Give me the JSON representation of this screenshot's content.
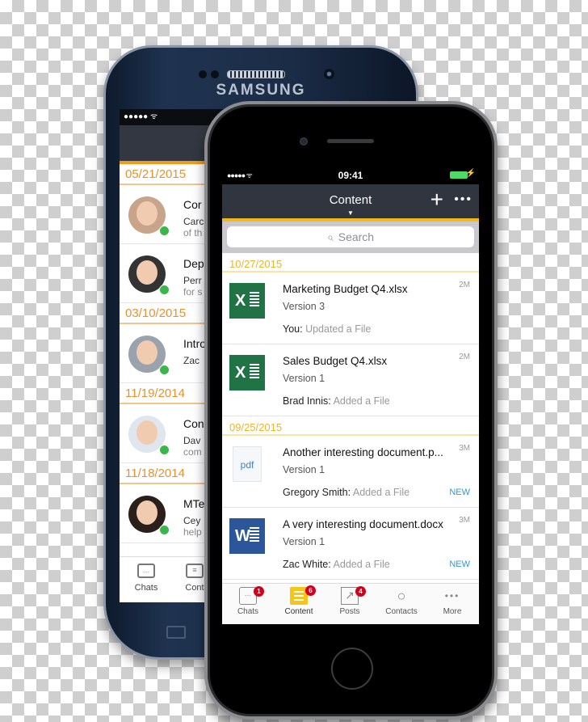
{
  "samsung": {
    "brand": "SAMSUNG",
    "status_signal": "●●●●● ᯤ",
    "groups": [
      {
        "date": "05/21/2015",
        "rows": [
          {
            "title": "Cor",
            "line1": "Carc",
            "line2": "of th"
          },
          {
            "title": "Dep",
            "line1": "Perr",
            "line2": "for s"
          }
        ]
      },
      {
        "date": "03/10/2015",
        "rows": [
          {
            "title": "Intro",
            "line1": "Zac",
            "line2": ""
          }
        ]
      },
      {
        "date": "11/19/2014",
        "rows": [
          {
            "title": "Con",
            "line1": "Dav",
            "line2": "com"
          }
        ]
      },
      {
        "date": "11/18/2014",
        "rows": [
          {
            "title": "MTe",
            "line1": "Cey",
            "line2": "help"
          }
        ]
      }
    ],
    "tabs": [
      {
        "label": "Chats",
        "icon": "chat-bubbles-icon"
      },
      {
        "label": "Cont",
        "icon": "content-list-icon"
      }
    ]
  },
  "iphone": {
    "status": {
      "signal": "●●●●● ᯤ",
      "time": "09:41",
      "charging": "⚡"
    },
    "nav": {
      "title": "Content",
      "caret": "▼",
      "add": "+",
      "more": "•••"
    },
    "search": {
      "icon": "⌕",
      "placeholder": "Search"
    },
    "groups": [
      {
        "date": "10/27/2015",
        "items": [
          {
            "type": "excel",
            "name": "Marketing Budget Q4.xlsx",
            "version": "Version 3",
            "actor": "You:",
            "action": "Updated a File",
            "age": "2M",
            "badge": ""
          },
          {
            "type": "excel",
            "name": "Sales Budget Q4.xlsx",
            "version": "Version 1",
            "actor": "Brad Innis:",
            "action": "Added a File",
            "age": "2M",
            "badge": ""
          }
        ]
      },
      {
        "date": "09/25/2015",
        "items": [
          {
            "type": "pdf",
            "name": "Another interesting document.p...",
            "version": "Version 1",
            "actor": "Gregory Smith:",
            "action": "Added a File",
            "age": "3M",
            "badge": "NEW"
          },
          {
            "type": "word",
            "name": "A very interesting document.docx",
            "version": "Version 1",
            "actor": "Zac White:",
            "action": "Added a File",
            "age": "3M",
            "badge": "NEW"
          }
        ]
      }
    ],
    "file_icons": {
      "excel": "X",
      "word": "W",
      "pdf": "pdf"
    },
    "tabs": [
      {
        "label": "Chats",
        "badge": "1",
        "glyph": "…"
      },
      {
        "label": "Content",
        "badge": "6",
        "glyph": ""
      },
      {
        "label": "Posts",
        "badge": "4",
        "glyph": "↗"
      },
      {
        "label": "Contacts",
        "badge": "",
        "glyph": "👤"
      },
      {
        "label": "More",
        "badge": "",
        "glyph": "•••"
      }
    ],
    "active_tab": "Content"
  },
  "colors": {
    "accent_yellow": "#f5b81c",
    "accent_orange": "#f29a1d",
    "nav_bg": "#30353f",
    "new_badge": "#2a9ad7",
    "online": "#3cb54a"
  }
}
